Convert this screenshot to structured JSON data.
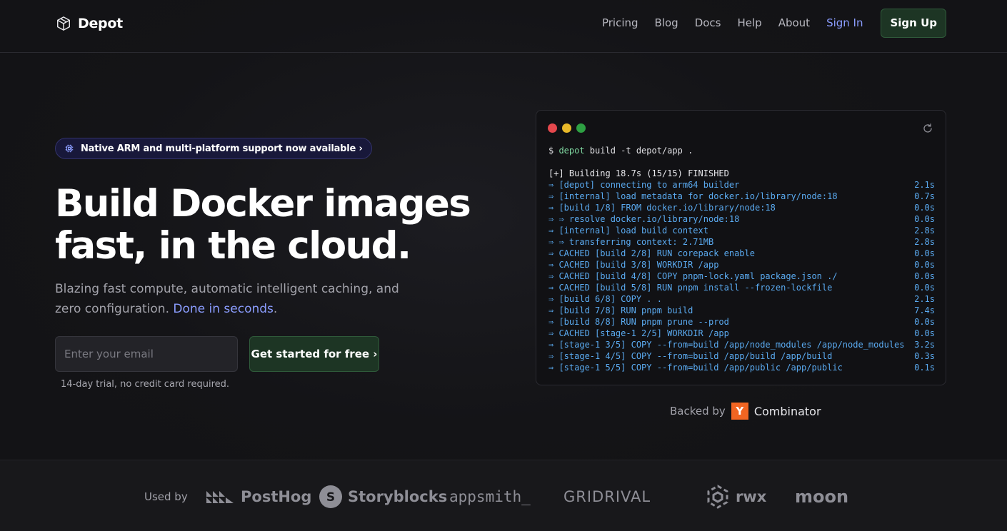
{
  "header": {
    "brand": "Depot",
    "nav": [
      "Pricing",
      "Blog",
      "Docs",
      "Help",
      "About"
    ],
    "sign_in": "Sign In",
    "sign_up": "Sign Up"
  },
  "hero": {
    "badge": "Native ARM and multi-platform support now available ›",
    "headline_line1": "Build Docker images",
    "headline_line2": "fast, in the cloud.",
    "sub_text": "Blazing fast compute, automatic intelligent caching, and zero configuration.",
    "sub_accent": "Done in seconds",
    "sub_end": ".",
    "email_placeholder": "Enter your email",
    "cta": "Get started for free ›",
    "trial": "14-day trial, no credit card required."
  },
  "terminal": {
    "prompt": "$ ",
    "cmd_name": "depot",
    "cmd_rest": " build -t depot/app .",
    "first_line": "[+] Building 18.7s (15/15) FINISHED",
    "lines": [
      {
        "text": "⇒ [depot] connecting to arm64 builder",
        "time": "2.1s"
      },
      {
        "text": "⇒ [internal] load metadata for docker.io/library/node:18",
        "time": "0.7s"
      },
      {
        "text": "⇒ [build 1/8] FROM docker.io/library/node:18",
        "time": "0.0s"
      },
      {
        "text": "⇒ ⇒ resolve docker.io/library/node:18",
        "time": "0.0s"
      },
      {
        "text": "⇒ [internal] load build context",
        "time": "2.8s"
      },
      {
        "text": "⇒ ⇒ transferring context: 2.71MB",
        "time": "2.8s"
      },
      {
        "text": "⇒ CACHED [build 2/8] RUN corepack enable",
        "time": "0.0s"
      },
      {
        "text": "⇒ CACHED [build 3/8] WORKDIR /app",
        "time": "0.0s"
      },
      {
        "text": "⇒ CACHED [build 4/8] COPY pnpm-lock.yaml package.json ./",
        "time": "0.0s"
      },
      {
        "text": "⇒ CACHED [build 5/8] RUN pnpm install --frozen-lockfile",
        "time": "0.0s"
      },
      {
        "text": "⇒ [build 6/8] COPY . .",
        "time": "2.1s"
      },
      {
        "text": "⇒ [build 7/8] RUN pnpm build",
        "time": "7.4s"
      },
      {
        "text": "⇒ [build 8/8] RUN pnpm prune --prod",
        "time": "0.0s"
      },
      {
        "text": "⇒ CACHED [stage-1 2/5] WORKDIR /app",
        "time": "0.0s"
      },
      {
        "text": "⇒ [stage-1 3/5] COPY --from=build /app/node_modules /app/node_modules",
        "time": "3.2s"
      },
      {
        "text": "⇒ [stage-1 4/5] COPY --from=build /app/build /app/build",
        "time": "0.3s"
      },
      {
        "text": "⇒ [stage-1 5/5] COPY --from=build /app/public /app/public",
        "time": "0.1s"
      }
    ]
  },
  "backed": {
    "label": "Backed by",
    "yc_letter": "Y",
    "combinator": "Combinator"
  },
  "used_by": {
    "label": "Used by",
    "logos": [
      "PostHog",
      "Storyblocks",
      "appsmith_",
      "GRIDRIVAL",
      "rwx",
      "moon"
    ]
  },
  "colors": {
    "accent": "#8b9dff",
    "cta_green": "#1d3524",
    "terminal_blue": "#5aaaf0",
    "yc_orange": "#f26522"
  }
}
